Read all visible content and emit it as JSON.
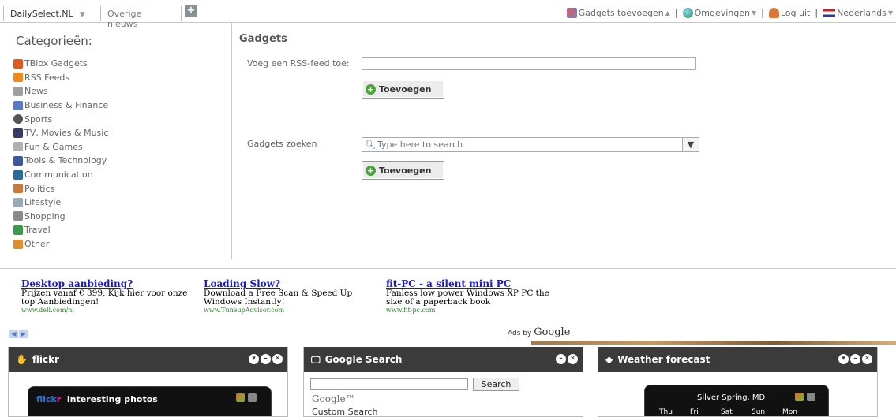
{
  "tabs": [
    {
      "label": "DailySelect.NL",
      "active": true
    },
    {
      "label": "Overige nieuws",
      "active": false
    }
  ],
  "add_tab_symbol": "+",
  "toplinks": {
    "gadgets": "Gadgets toevoegen",
    "environments": "Omgevingen",
    "logout": "Log uit",
    "language": "Nederlands",
    "separator": "|"
  },
  "sidebar": {
    "heading": "Categorieën:",
    "categories": [
      {
        "label": "TBlox Gadgets",
        "color": "#e05a1e"
      },
      {
        "label": "RSS Feeds",
        "color": "#f28a1a"
      },
      {
        "label": "News",
        "color": "#a0a0a0"
      },
      {
        "label": "Business & Finance",
        "color": "#5a7ac8"
      },
      {
        "label": "Sports",
        "color": "#555555"
      },
      {
        "label": "TV, Movies & Music",
        "color": "#3a3a6a"
      },
      {
        "label": "Fun & Games",
        "color": "#b0b0b0"
      },
      {
        "label": "Tools & Technology",
        "color": "#3a5a9a"
      },
      {
        "label": "Communication",
        "color": "#2a6a9a"
      },
      {
        "label": "Politics",
        "color": "#c87a3a"
      },
      {
        "label": "Lifestyle",
        "color": "#9aa8b8"
      },
      {
        "label": "Shopping",
        "color": "#8a8a8a"
      },
      {
        "label": "Travel",
        "color": "#3a9a4a"
      },
      {
        "label": "Other",
        "color": "#e0902a"
      }
    ]
  },
  "main": {
    "heading": "Gadgets",
    "rss_label": "Voeg een RSS-feed toe:",
    "rss_value": "",
    "add_button": "Toevoegen",
    "search_label": "Gadgets zoeken",
    "search_placeholder": "Type here to search",
    "add_button2": "Toevoegen"
  },
  "ads": [
    {
      "title": "Desktop aanbieding?",
      "desc": "Prijzen vanaf € 399, Kijk hier voor onze top Aanbiedingen!",
      "url": "www.dell.com/nl"
    },
    {
      "title": "Loading Slow?",
      "desc": "Download a Free Scan & Speed Up Windows Instantly!",
      "url": "www.TuneupAdvisor.com"
    },
    {
      "title": "fit-PC - a silent mini PC",
      "desc": "Fanless low power Windows XP PC the size of a paperback book",
      "url": "www.fit-pc.com"
    }
  ],
  "ads_by": "Ads by",
  "ads_brand": "Google",
  "widgets": {
    "flickr": {
      "title": "flickr",
      "inner_title": "interesting photos",
      "brand_a": "flick",
      "brand_b": "r"
    },
    "google": {
      "title": "Google Search",
      "button": "Search",
      "logo": "Google™",
      "custom": "Custom Search"
    },
    "weather": {
      "title": "Weather forecast",
      "location": "Silver Spring, MD",
      "days": [
        "Thu",
        "Fri",
        "Sat",
        "Sun",
        "Mon"
      ]
    }
  },
  "colors": {
    "widget_header": "#3b3b3b",
    "link_blue": "#1a1acc",
    "ad_url": "#2a8a2a"
  }
}
